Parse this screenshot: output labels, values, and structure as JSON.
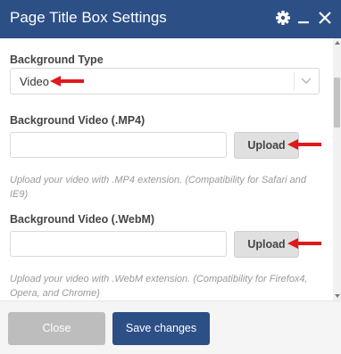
{
  "dialog": {
    "title": "Page Title Box Settings",
    "icons": [
      "gear-icon",
      "minimize-icon",
      "close-icon"
    ]
  },
  "background_type": {
    "label": "Background Type",
    "value": "Video"
  },
  "mp4": {
    "label": "Background Video (.MP4)",
    "value": "",
    "button": "Upload",
    "help": "Upload your video with .MP4 extension. (Compatibility for Safari and IE9)"
  },
  "webm": {
    "label": "Background Video (.WebM)",
    "value": "",
    "button": "Upload",
    "help": "Upload your video with .WebM extension. (Compatibility for Firefox4, Opera, and Chrome)"
  },
  "footer": {
    "close_label": "Close",
    "save_label": "Save changes"
  },
  "colors": {
    "header": "#2c4f86",
    "primary_button": "#2c4f86",
    "disabled_button": "#bdbdbd",
    "annotation_arrow": "#e0191b"
  }
}
